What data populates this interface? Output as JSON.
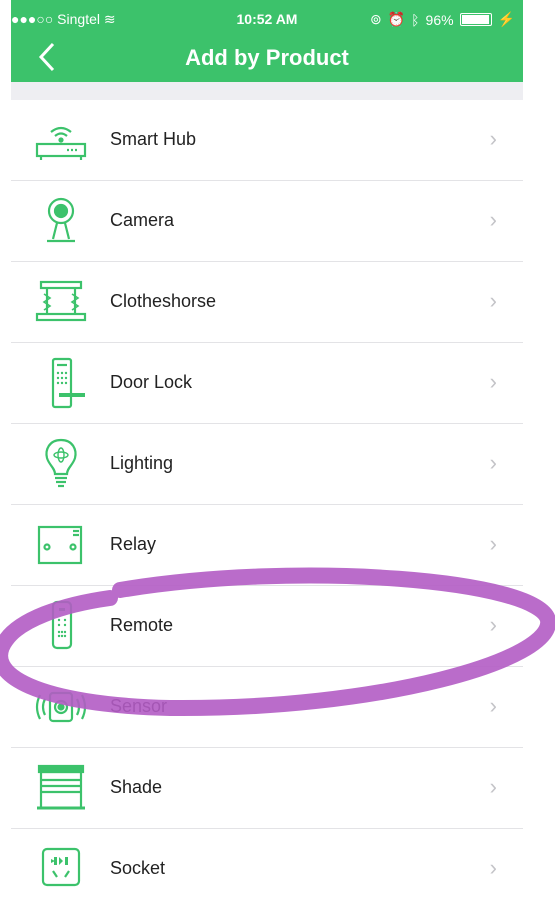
{
  "status_bar": {
    "signal": "●●●○○",
    "carrier": "Singtel",
    "wifi_icon": "wifi-icon",
    "time": "10:52 AM",
    "battery": "96%",
    "battery_level": 0.96
  },
  "navbar": {
    "back_icon": "chevron-left-icon",
    "title": "Add by Product"
  },
  "products": [
    {
      "label": "Smart Hub",
      "icon": "hub-icon"
    },
    {
      "label": "Camera",
      "icon": "camera-icon"
    },
    {
      "label": "Clotheshorse",
      "icon": "clotheshorse-icon"
    },
    {
      "label": "Door Lock",
      "icon": "door-lock-icon"
    },
    {
      "label": "Lighting",
      "icon": "bulb-icon"
    },
    {
      "label": "Relay",
      "icon": "relay-icon"
    },
    {
      "label": "Remote",
      "icon": "remote-icon"
    },
    {
      "label": "Sensor",
      "icon": "sensor-icon"
    },
    {
      "label": "Shade",
      "icon": "shade-icon"
    },
    {
      "label": "Socket",
      "icon": "socket-icon"
    }
  ],
  "chevron": "›",
  "colors": {
    "accent": "#3cc26b",
    "highlight": "#b35cc4"
  }
}
